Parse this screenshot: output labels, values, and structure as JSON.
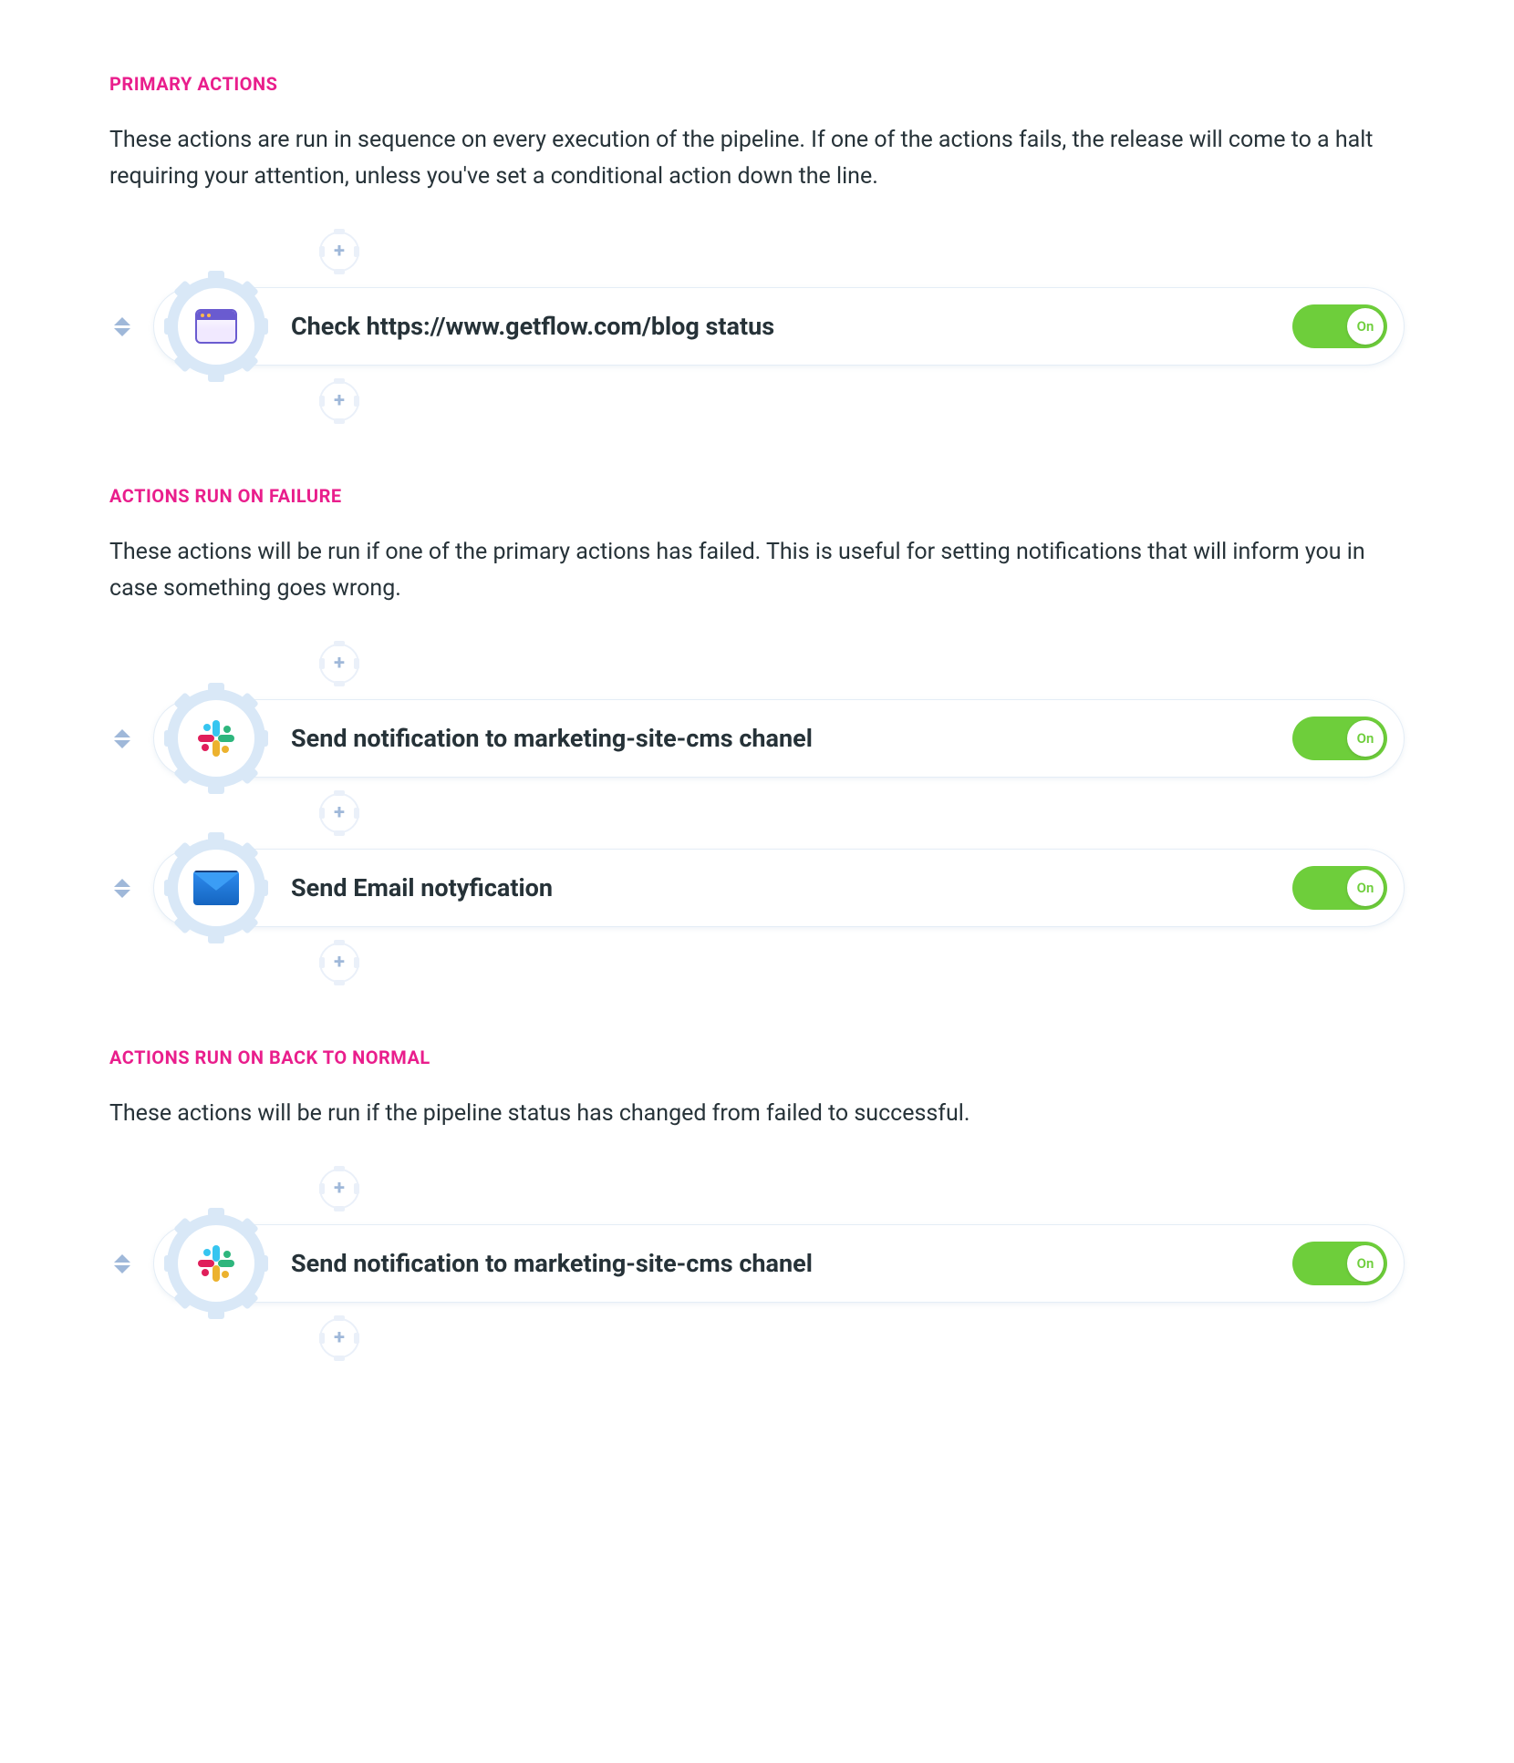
{
  "sections": {
    "primary": {
      "heading": "PRIMARY ACTIONS",
      "description": "These actions are run in sequence on every execution of the pipeline. If one of the actions fails, the release will come to a halt requiring your attention, unless you've set a conditional action down the line.",
      "actions": [
        {
          "icon": "browser",
          "title": "Check https://www.getflow.com/blog status",
          "toggle": "On"
        }
      ]
    },
    "failure": {
      "heading": "ACTIONS RUN ON FAILURE",
      "description": "These actions will be run if one of the primary actions has failed. This is useful for setting notifications that will inform you in case something goes wrong.",
      "actions": [
        {
          "icon": "slack",
          "title": "Send notification to marketing-site-cms chanel",
          "toggle": "On"
        },
        {
          "icon": "email",
          "title": "Send Email notyfication",
          "toggle": "On"
        }
      ]
    },
    "normal": {
      "heading": "ACTIONS RUN ON BACK TO NORMAL",
      "description": "These actions will be run if the pipeline status has changed from failed to successful.",
      "actions": [
        {
          "icon": "slack",
          "title": "Send notification to marketing-site-cms chanel",
          "toggle": "On"
        }
      ]
    }
  },
  "colors": {
    "accent_pink": "#e91e8c",
    "toggle_green": "#6ece3b",
    "gear_blue": "#d9e8f7"
  }
}
